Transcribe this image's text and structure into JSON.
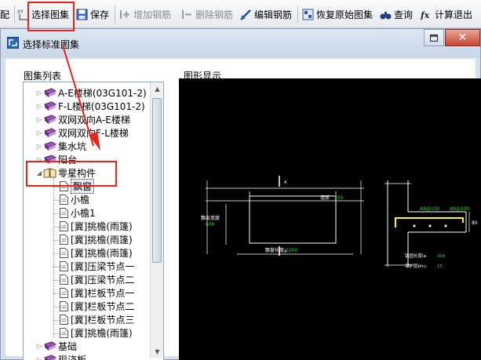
{
  "toolbar": {
    "partial_left": "配",
    "select_atlas": "选择图集",
    "save": "保存",
    "add_rebar": "增加钢筋",
    "delete_rebar": "删除钢筋",
    "edit_rebar": "编辑钢筋",
    "restore_atlas": "恢复原始图集",
    "query": "查询",
    "calc_exit": "计算退出",
    "xy_label": "XY"
  },
  "window": {
    "title": "选择标准图集",
    "close_glyph": "✕"
  },
  "tree": {
    "label": "图集列表",
    "items": [
      {
        "label": "A-E楼梯(03G101-2)",
        "kind": "book",
        "state": "collapsed"
      },
      {
        "label": "F-L楼梯(03G101-2)",
        "kind": "book",
        "state": "collapsed"
      },
      {
        "label": "双网双向A-E楼梯",
        "kind": "book",
        "state": "collapsed"
      },
      {
        "label": "双网双向F-L楼梯",
        "kind": "book",
        "state": "collapsed"
      },
      {
        "label": "集水坑",
        "kind": "book",
        "state": "collapsed"
      },
      {
        "label": "阳台",
        "kind": "book",
        "state": "collapsed"
      },
      {
        "label": "零星构件",
        "kind": "book",
        "state": "expanded"
      },
      {
        "label": "飘窗",
        "kind": "doc",
        "state": "selected"
      },
      {
        "label": "小檐",
        "kind": "doc"
      },
      {
        "label": "小檐1",
        "kind": "doc"
      },
      {
        "label": "[冀]挑檐(雨篷)",
        "kind": "doc"
      },
      {
        "label": "[冀]挑檐(雨篷)",
        "kind": "doc"
      },
      {
        "label": "[冀]挑檐(雨篷)",
        "kind": "doc"
      },
      {
        "label": "[冀]压梁节点一",
        "kind": "doc"
      },
      {
        "label": "[冀]压梁节点二",
        "kind": "doc"
      },
      {
        "label": "[冀]栏板节点一",
        "kind": "doc"
      },
      {
        "label": "[冀]栏板节点二",
        "kind": "doc"
      },
      {
        "label": "[冀]栏板节点三",
        "kind": "doc"
      },
      {
        "label": "[冀]挑檐(雨篷)",
        "kind": "doc"
      },
      {
        "label": "基础",
        "kind": "book",
        "state": "collapsed"
      },
      {
        "label": "现浇板",
        "kind": "book",
        "state": "collapsed"
      }
    ]
  },
  "drawing": {
    "label": "图形显示",
    "fig1": {
      "marker_top": "A",
      "marker_bottom": "A",
      "top_dim": "墙厚",
      "top_dim_val": "250",
      "left_label": "飘出宽度",
      "left_val": "600",
      "bottom_label": "飘窗长度",
      "bottom_val": "3200"
    },
    "fig2": {
      "rebar1": "A8@150",
      "rebar2": "A8@200",
      "right_val": "80",
      "anchor_label": "锚固长度la:",
      "anchor_val": "30d",
      "cover_label": "保护层bhc:",
      "cover_val": "15"
    }
  },
  "colors": {
    "annotation_red": "#e8231c",
    "drawing_bg": "#000000",
    "line_white": "#ffffff",
    "dim_green": "#2bd02b",
    "rebar_yellow": "#ffff00"
  }
}
